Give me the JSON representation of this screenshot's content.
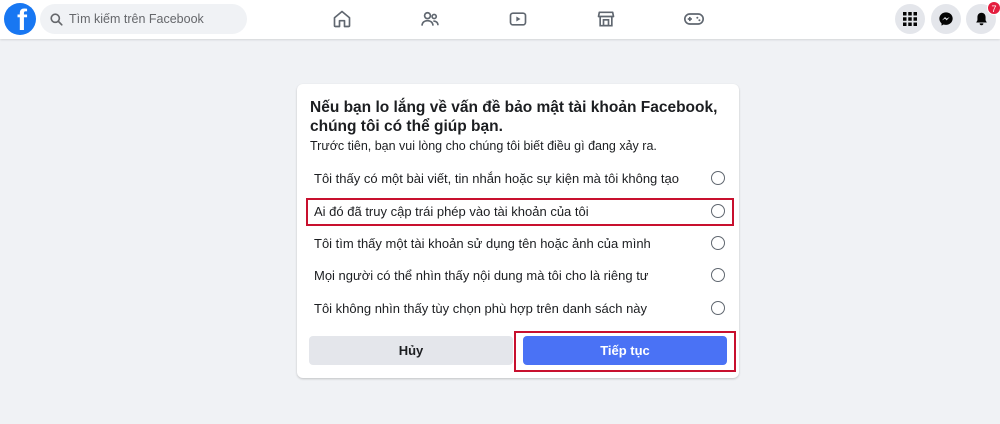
{
  "header": {
    "logo_letter": "f",
    "search": {
      "placeholder": "Tìm kiếm trên Facebook"
    },
    "nav": [
      {
        "name": "home",
        "icon": "home-icon"
      },
      {
        "name": "friends",
        "icon": "friends-icon"
      },
      {
        "name": "watch",
        "icon": "video-icon"
      },
      {
        "name": "marketplace",
        "icon": "marketplace-icon"
      },
      {
        "name": "gaming",
        "icon": "gaming-icon"
      }
    ],
    "right_icons": [
      {
        "name": "menu",
        "icon": "grid-menu-icon"
      },
      {
        "name": "messenger",
        "icon": "messenger-icon"
      },
      {
        "name": "notifications",
        "icon": "bell-icon",
        "badge": "7"
      }
    ]
  },
  "dialog": {
    "title": "Nếu bạn lo lắng về vấn đề bảo mật tài khoản Facebook, chúng tôi có thể giúp bạn.",
    "subtitle": "Trước tiên, bạn vui lòng cho chúng tôi biết điều gì đang xảy ra.",
    "options": [
      {
        "label": "Tôi thấy có một bài viết, tin nhắn hoặc sự kiện mà tôi không tạo",
        "selected": false
      },
      {
        "label": "Ai đó đã truy cập trái phép vào tài khoản của tôi",
        "selected": false,
        "highlighted": true
      },
      {
        "label": "Tôi tìm thấy một tài khoản sử dụng tên hoặc ảnh của mình",
        "selected": false
      },
      {
        "label": "Mọi người có thể nhìn thấy nội dung mà tôi cho là riêng tư",
        "selected": false
      },
      {
        "label": "Tôi không nhìn thấy tùy chọn phù hợp trên danh sách này",
        "selected": false
      }
    ],
    "cancel_label": "Hủy",
    "continue_label": "Tiếp tục"
  },
  "colors": {
    "brand": "#1877f2",
    "primary_button": "#4a72f5",
    "highlight": "#c8102e",
    "page_bg": "#f0f2f5",
    "badge": "#e41e3f"
  }
}
